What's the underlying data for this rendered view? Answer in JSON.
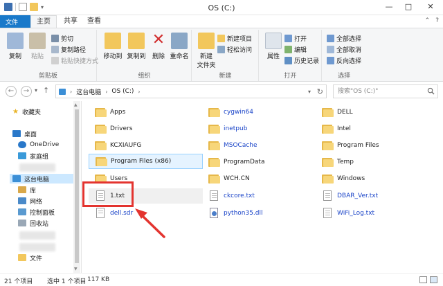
{
  "window": {
    "title": "OS (C:)",
    "min": "—",
    "max": "□",
    "close": "✕"
  },
  "ribbon_tabs": {
    "file": "文件",
    "home": "主页",
    "share": "共享",
    "view": "查看"
  },
  "ribbon": {
    "clipboard": {
      "label": "剪贴板",
      "copy": "复制",
      "paste": "粘贴",
      "cut": "剪切",
      "copy_path": "复制路径",
      "paste_shortcut": "粘贴快捷方式"
    },
    "organize": {
      "label": "组织",
      "move_to": "移动到",
      "copy_to": "复制到",
      "delete": "删除",
      "rename": "重命名"
    },
    "new": {
      "label": "新建",
      "new_folder": "新建\n文件夹",
      "new_item": "新建项目",
      "easy_access": "轻松访问"
    },
    "open": {
      "label": "打开",
      "properties": "属性",
      "open": "打开",
      "edit": "编辑",
      "history": "历史记录"
    },
    "select": {
      "label": "选择",
      "select_all": "全部选择",
      "select_none": "全部取消",
      "invert": "反向选择"
    }
  },
  "address": {
    "crumbs": [
      "这台电脑",
      "OS (C:)"
    ],
    "search_placeholder": "搜索\"OS (C:)\""
  },
  "nav": {
    "favorites": "收藏夹",
    "desktop": "桌面",
    "onedrive": "OneDrive",
    "homegroup": "家庭组",
    "this_pc": "这台电脑",
    "libraries": "库",
    "network": "网络",
    "control_panel": "控制面板",
    "recycle_bin": "回收站",
    "files": "文件"
  },
  "files": [
    {
      "name": "Apps",
      "type": "folder"
    },
    {
      "name": "Drivers",
      "type": "folder"
    },
    {
      "name": "KCXIAUFG",
      "type": "folder"
    },
    {
      "name": "Program Files (x86)",
      "type": "folder"
    },
    {
      "name": "Users",
      "type": "folder"
    },
    {
      "name": "1.txt",
      "type": "txt"
    },
    {
      "name": "dell.sdr",
      "type": "txt"
    },
    {
      "name": "cygwin64",
      "type": "folder"
    },
    {
      "name": "inetpub",
      "type": "folder"
    },
    {
      "name": "MSOCache",
      "type": "folder"
    },
    {
      "name": "ProgramData",
      "type": "folder"
    },
    {
      "name": "WCH.CN",
      "type": "folder"
    },
    {
      "name": "ckcore.txt",
      "type": "txt"
    },
    {
      "name": "python35.dll",
      "type": "dll"
    },
    {
      "name": "DELL",
      "type": "folder"
    },
    {
      "name": "Intel",
      "type": "folder"
    },
    {
      "name": "Program Files",
      "type": "folder"
    },
    {
      "name": "Temp",
      "type": "folder"
    },
    {
      "name": "Windows",
      "type": "folder"
    },
    {
      "name": "DBAR_Ver.txt",
      "type": "txt"
    },
    {
      "name": "WiFi_Log.txt",
      "type": "txt"
    }
  ],
  "status": {
    "count": "21 个项目",
    "selected": "选中 1 个项目",
    "size": "117 KB"
  },
  "colors": {
    "accent": "#1979ca",
    "folder": "#f7d67a",
    "annotation": "#e3342f",
    "selection": "#cce8ff"
  }
}
